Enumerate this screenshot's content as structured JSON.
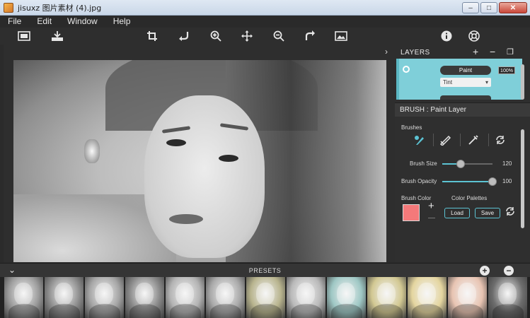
{
  "window": {
    "title": "jisuxz 图片素材 (4).jpg",
    "buttons": [
      "–",
      "□",
      "✕"
    ]
  },
  "menu": [
    "File",
    "Edit",
    "Window",
    "Help"
  ],
  "toolbar": {
    "left_icons": [
      "image-icon",
      "save-icon"
    ],
    "center_icons": [
      "crop-icon",
      "rotate-left-icon",
      "zoom-in-icon",
      "move-icon",
      "zoom-out-icon",
      "rotate-right-icon",
      "fit-image-icon"
    ],
    "right_icons": [
      "info-icon",
      "help-icon"
    ]
  },
  "layers": {
    "title": "LAYERS",
    "layer": {
      "name": "Paint",
      "opacity": "100%",
      "blend": "Tint"
    }
  },
  "brush": {
    "title": "BRUSH : Paint Layer",
    "brushes_label": "Brushes",
    "size_label": "Brush Size",
    "size_value": "120",
    "size_fraction": 0.36,
    "opacity_label": "Brush Opacity",
    "opacity_value": "100",
    "opacity_fraction": 1.0,
    "color_label": "Brush Color",
    "color": "#f4797a",
    "palettes_label": "Color Palettes",
    "load_label": "Load",
    "save_label": "Save"
  },
  "presets": {
    "title": "PRESETS",
    "thumbnails": [
      {
        "tint": "#9b9b9b"
      },
      {
        "tint": "#8f8f8f"
      },
      {
        "tint": "#a4a4a4"
      },
      {
        "tint": "#8a8a8a"
      },
      {
        "tint": "#b3b3b3"
      },
      {
        "tint": "#a9a9a9"
      },
      {
        "tint": "#b8b48e"
      },
      {
        "tint": "#b9b9b9"
      },
      {
        "tint": "#9ec7c4"
      },
      {
        "tint": "#d2c892"
      },
      {
        "tint": "#e4d59f"
      },
      {
        "tint": "#e8c4b2"
      },
      {
        "tint": "#6d6d6d"
      }
    ]
  },
  "colors": {
    "accent": "#5cc3d3",
    "layer_bg": "#7fcfd9",
    "panel_bg": "#2e2e2e"
  }
}
